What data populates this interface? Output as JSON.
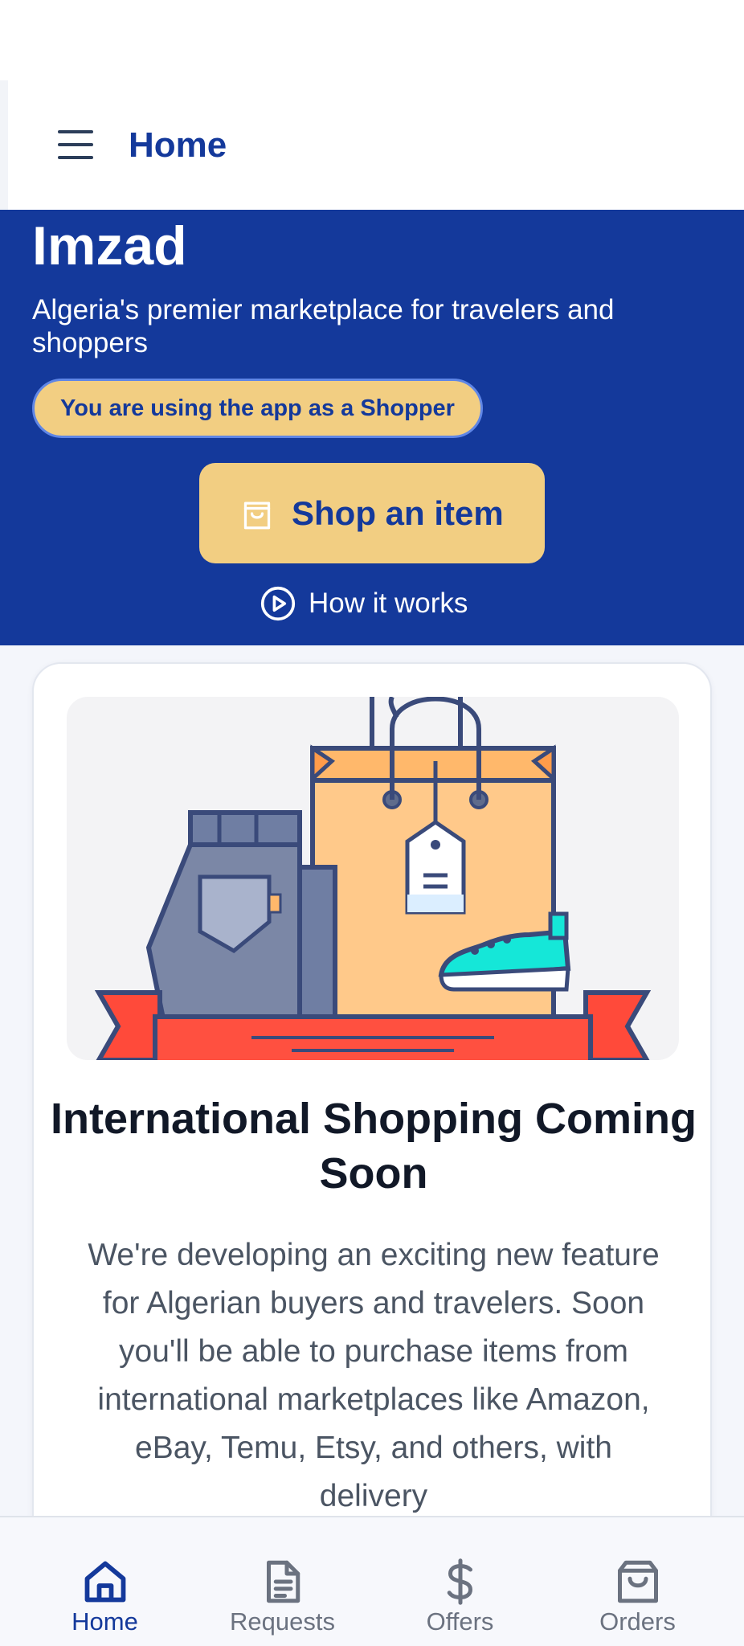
{
  "header": {
    "title": "Home"
  },
  "hero": {
    "app_name": "Imzad",
    "tagline": "Algeria's premier marketplace for travelers and shoppers",
    "role_badge": "You are using the app as a Shopper",
    "shop_button": "Shop an item",
    "how_it_works": "How it works"
  },
  "card": {
    "title": "International Shopping Coming Soon",
    "body": "We're developing an exciting new feature for Algerian buyers and travelers. Soon you'll be able to purchase items from international marketplaces like Amazon, eBay, Temu, Etsy, and others, with delivery"
  },
  "bottom_nav": {
    "items": [
      {
        "label": "Home",
        "icon": "home-icon",
        "active": true
      },
      {
        "label": "Requests",
        "icon": "document-icon",
        "active": false
      },
      {
        "label": "Offers",
        "icon": "dollar-icon",
        "active": false
      },
      {
        "label": "Orders",
        "icon": "shopping-bag-icon",
        "active": false
      }
    ]
  },
  "colors": {
    "brand_blue": "#14399b",
    "accent_yellow": "#f2ce82",
    "inactive_gray": "#6b7280"
  }
}
